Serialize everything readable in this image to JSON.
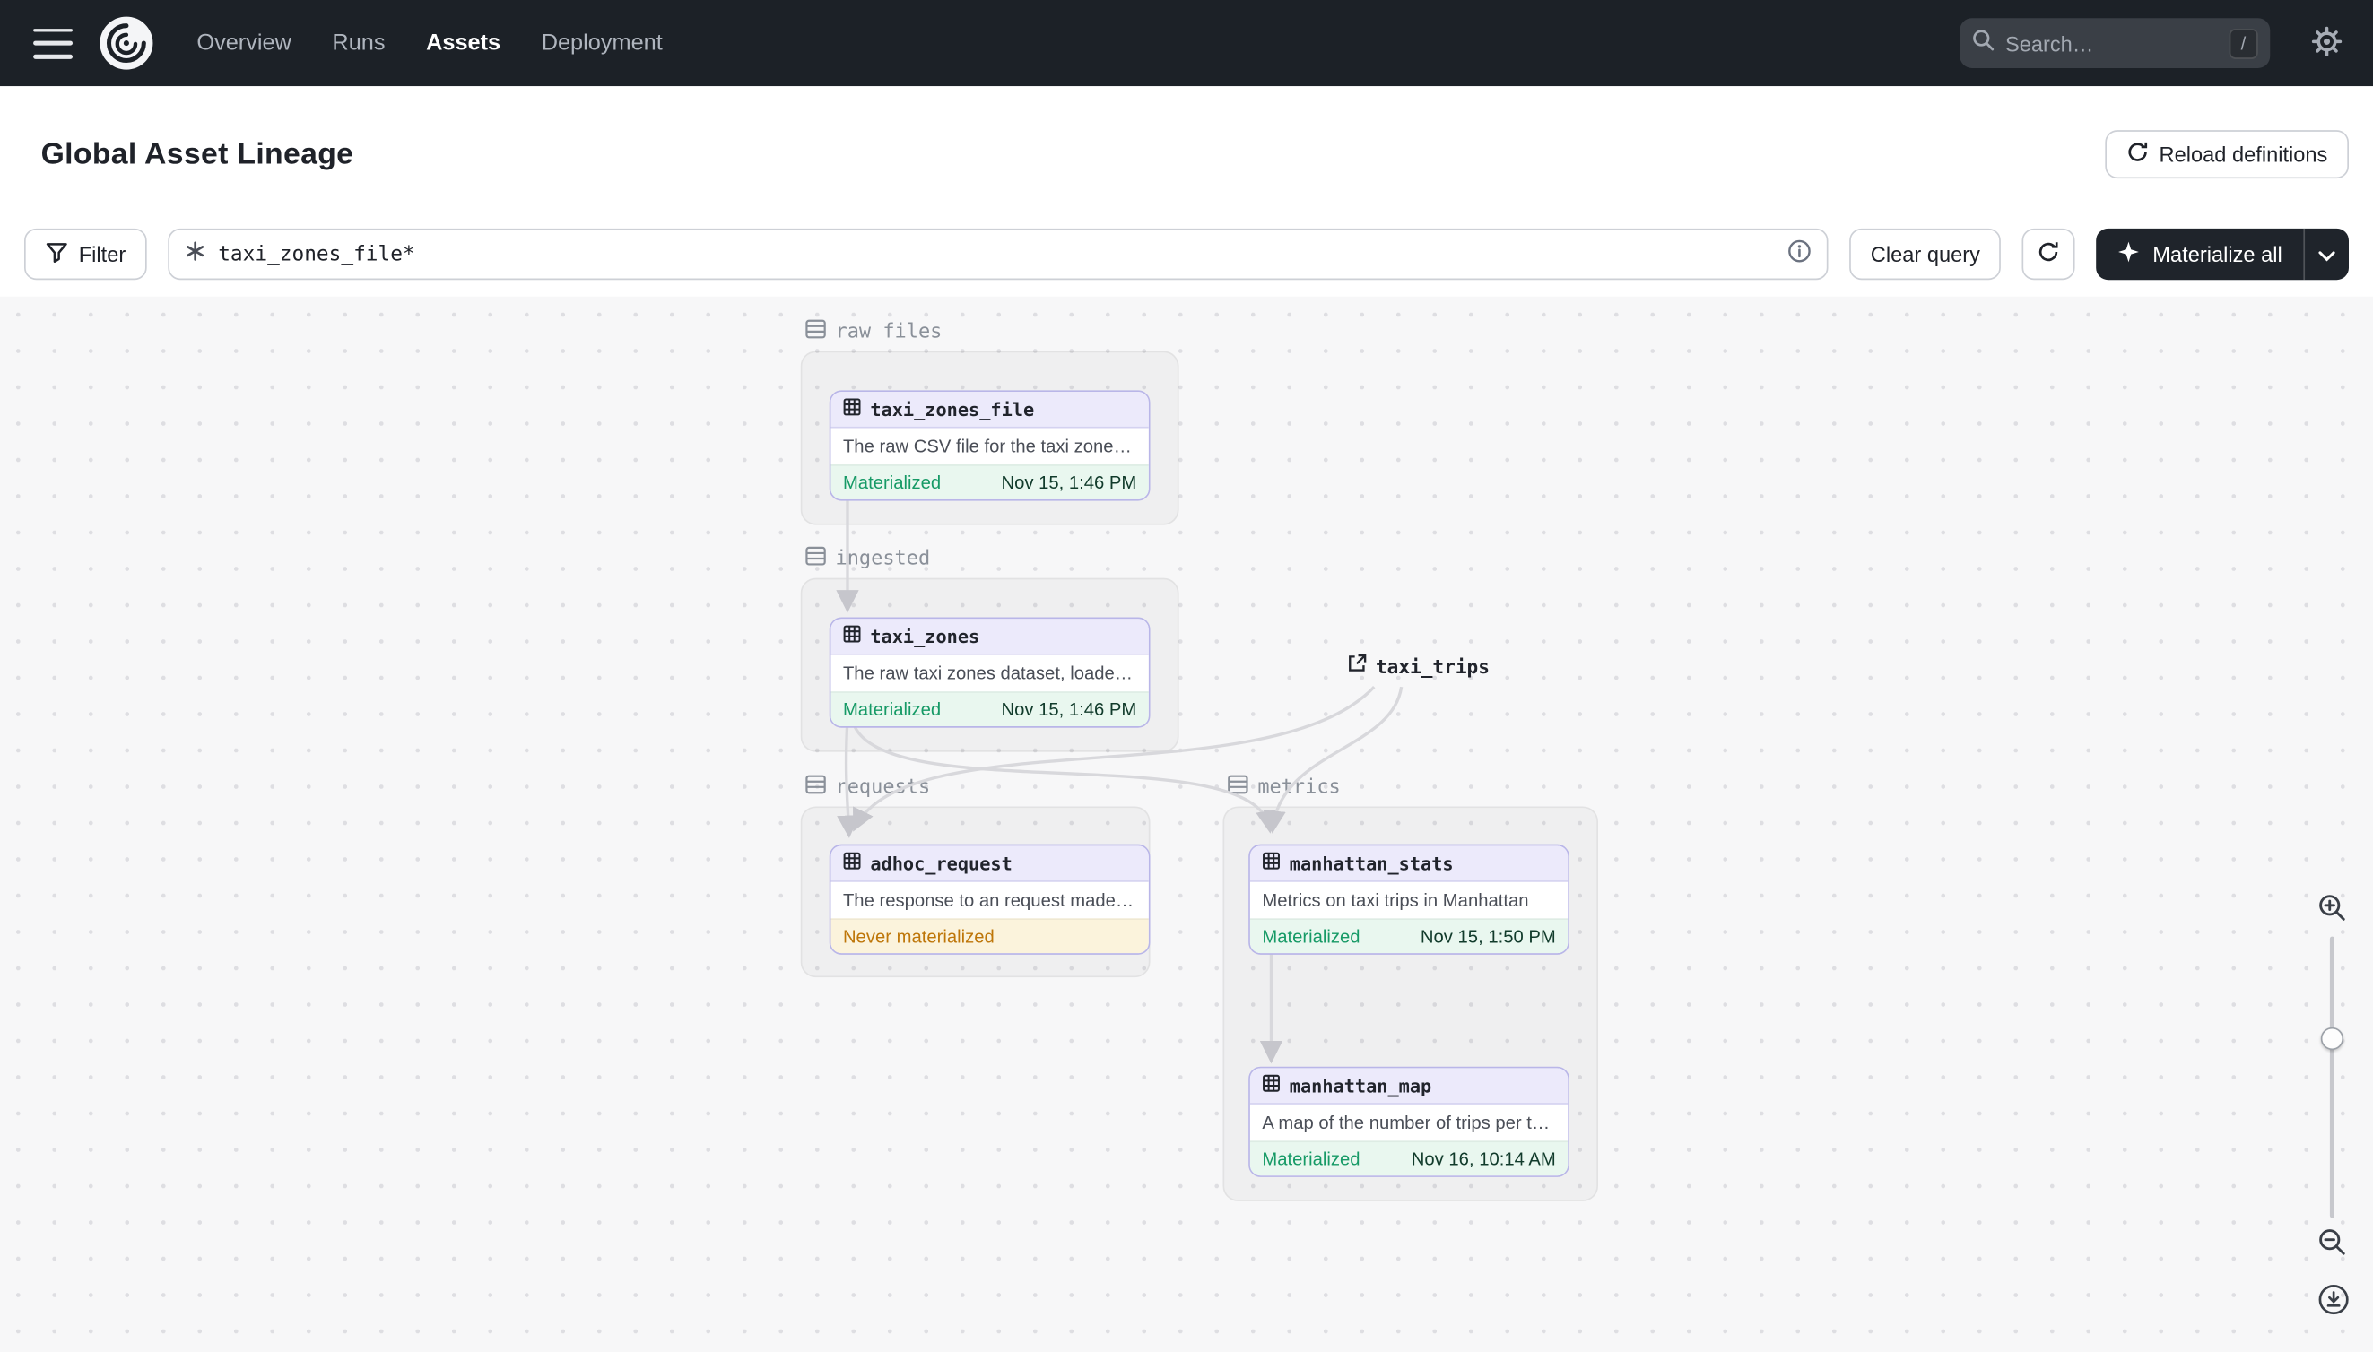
{
  "colors": {
    "nav_bg": "#1C2127",
    "node_header_lavender": "#ECEAFB",
    "node_border_purple": "#B9B6E8",
    "materialized_green": "#169A66",
    "never_materialized_amber": "#BE7609",
    "canvas_bg": "#F7F7F8",
    "edge_gray": "#D8D8DC"
  },
  "nav": {
    "items": [
      {
        "label": "Overview",
        "active": false
      },
      {
        "label": "Runs",
        "active": false
      },
      {
        "label": "Assets",
        "active": true
      },
      {
        "label": "Deployment",
        "active": false
      }
    ],
    "search": {
      "placeholder": "Search…",
      "shortcut": "/"
    }
  },
  "header": {
    "title": "Global Asset Lineage",
    "reload_button_label": "Reload definitions"
  },
  "toolbar": {
    "filter_label": "Filter",
    "query_value": "taxi_zones_file*",
    "clear_query_label": "Clear query",
    "materialize_label": "Materialize all"
  },
  "graph": {
    "groups": [
      {
        "name": "raw_files"
      },
      {
        "name": "ingested"
      },
      {
        "name": "requests"
      },
      {
        "name": "metrics"
      }
    ],
    "nodes": [
      {
        "name": "taxi_zones_file",
        "description": "The raw CSV file for the taxi zones dat…",
        "status": "Materialized",
        "timestamp": "Nov 15, 1:46 PM"
      },
      {
        "name": "taxi_zones",
        "description": "The raw taxi zones dataset, loaded int…",
        "status": "Materialized",
        "timestamp": "Nov 15, 1:46 PM"
      },
      {
        "name": "adhoc_request",
        "description": "The response to an request made in th…",
        "status": "Never materialized",
        "timestamp": ""
      },
      {
        "name": "manhattan_stats",
        "description": "Metrics on taxi trips in Manhattan",
        "status": "Materialized",
        "timestamp": "Nov 15, 1:50 PM"
      },
      {
        "name": "manhattan_map",
        "description": "A map of the number of trips per taxi z…",
        "status": "Materialized",
        "timestamp": "Nov 16, 10:14 AM"
      }
    ],
    "external": [
      {
        "name": "taxi_trips"
      }
    ]
  },
  "icons": {
    "hamburger-menu-icon": "three horizontal bars",
    "dagster-logo": "white circle with dark swirl",
    "search-icon": "magnifier",
    "slash-shortcut-badge": "/",
    "gear-icon": "settings gear",
    "reload-icon": "circular arrow",
    "filter-icon": "funnel",
    "selector-icon": "asterisk",
    "info-icon": "circled i",
    "refresh-icon": "circular arrow",
    "materialize-icon": "four point sparkle",
    "caret-down-icon": "chevron down",
    "table-icon": "grid table",
    "group-icon": "stacked rows",
    "external-link-icon": "box with arrow",
    "zoom-in-icon": "magnifier plus",
    "zoom-out-icon": "magnifier minus",
    "download-icon": "circled down arrow"
  }
}
